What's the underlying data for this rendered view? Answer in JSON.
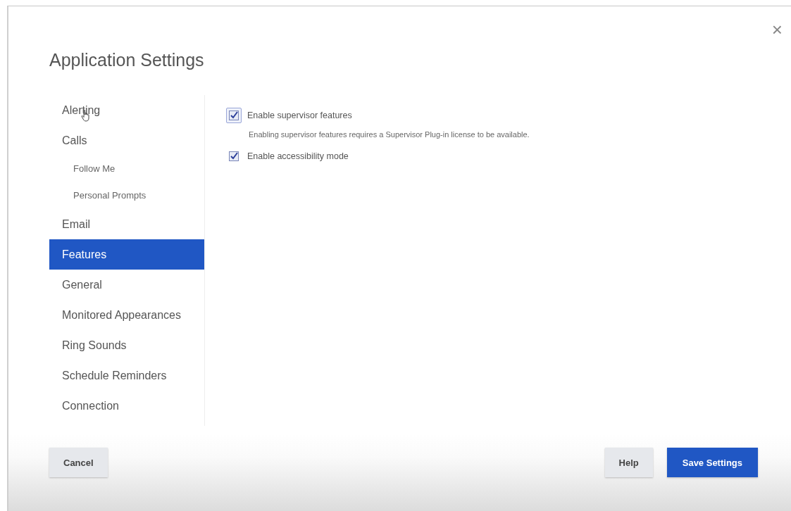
{
  "dialog": {
    "title": "Application Settings",
    "close": "×"
  },
  "sidebar": {
    "items": [
      {
        "label": "Alerting",
        "selected": false
      },
      {
        "label": "Calls",
        "selected": false,
        "children": [
          {
            "label": "Follow Me",
            "selected": false
          },
          {
            "label": "Personal Prompts",
            "selected": false
          }
        ]
      },
      {
        "label": "Email",
        "selected": false
      },
      {
        "label": "Features",
        "selected": true
      },
      {
        "label": "General",
        "selected": false
      },
      {
        "label": "Monitored Appearances",
        "selected": false
      },
      {
        "label": "Ring Sounds",
        "selected": false
      },
      {
        "label": "Schedule Reminders",
        "selected": false
      },
      {
        "label": "Connection",
        "selected": false
      }
    ]
  },
  "settings": [
    {
      "label": "Enable supervisor features",
      "checked": true,
      "focused": true,
      "note": "Enabling supervisor features requires a Supervisor Plug-in license to be available."
    },
    {
      "label": "Enable accessibility mode",
      "checked": true,
      "focused": false
    }
  ],
  "buttons": [
    {
      "label": "Cancel",
      "kind": "secondary"
    },
    {
      "label": "Help",
      "kind": "secondary"
    },
    {
      "label": "Save Settings",
      "kind": "primary"
    }
  ]
}
